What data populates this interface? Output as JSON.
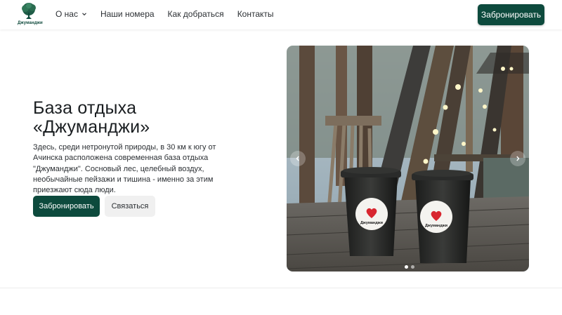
{
  "header": {
    "logo_text": "Джуманджи",
    "nav": [
      {
        "label": "О нас",
        "has_dropdown": true
      },
      {
        "label": "Наши номера"
      },
      {
        "label": "Как добраться"
      },
      {
        "label": "Контакты"
      }
    ],
    "cta_label": "Забронировать"
  },
  "hero": {
    "title_line1": "База отдыха",
    "title_line2": "«Джуманджи»",
    "description": "Здесь, среди нетронутой природы, в 30 км к югу от Ачинска расположена современная база отдыха \"Джуманджи\". Сосновый лес, целебный воздух, необычайные пейзажи и тишина - именно за этим приезжают сюда люди.",
    "primary_button": "Забронировать",
    "secondary_button": "Связаться"
  },
  "carousel": {
    "slide_count": 2,
    "active_slide": 1,
    "cup_sticker_text": "Джуманджи"
  },
  "colors": {
    "brand": "#0d4a3d",
    "secondary_button_bg": "#f0f0f0"
  },
  "icons": {
    "nav_dropdown": "chevron-down-icon",
    "prev": "chevron-left-icon",
    "next": "chevron-right-icon"
  }
}
